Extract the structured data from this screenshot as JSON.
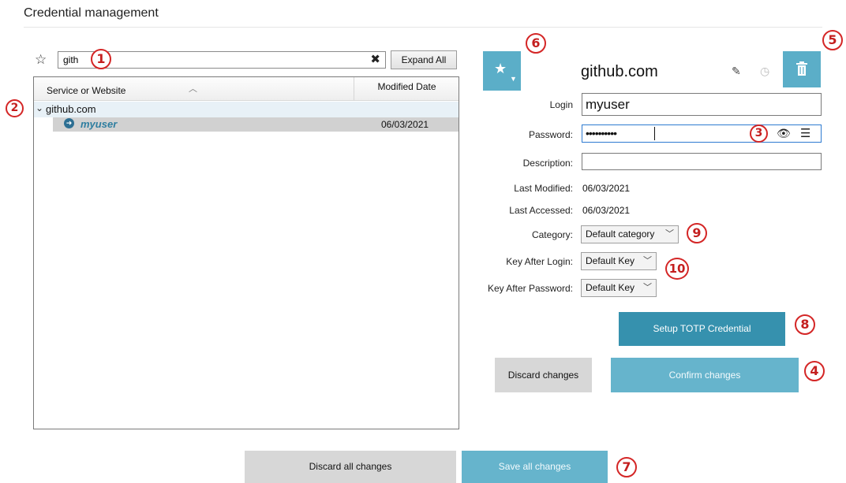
{
  "page": {
    "title": "Credential management"
  },
  "search": {
    "value": "gith",
    "clear_icon": "close-icon",
    "expand_label": "Expand All",
    "favorite_icon": "star-outline-icon"
  },
  "tree": {
    "columns": [
      "Service or Website",
      "Modified Date"
    ],
    "groups": [
      {
        "label": "github.com",
        "expanded": true,
        "items": [
          {
            "user": "myuser",
            "modified": "06/03/2021",
            "selected": true
          }
        ]
      }
    ]
  },
  "detail": {
    "service_name": "github.com",
    "icons": {
      "favorite": "star-icon",
      "edit": "edit-icon",
      "history": "history-icon",
      "delete": "trash-icon"
    },
    "login_label": "Login",
    "login_value": "myuser",
    "password_label": "Password:",
    "password_masked": "••••••••••",
    "description_label": "Description:",
    "description_value": "",
    "last_modified_label": "Last Modified:",
    "last_modified_value": "06/03/2021",
    "last_accessed_label": "Last Accessed:",
    "last_accessed_value": "06/03/2021",
    "category_label": "Category:",
    "category_value": "Default category",
    "key_after_login_label": "Key After Login:",
    "key_after_login_value": "Default Key",
    "key_after_password_label": "Key After Password:",
    "key_after_password_value": "Default Key"
  },
  "actions": {
    "totp": "Setup TOTP Credential",
    "discard": "Discard changes",
    "confirm": "Confirm changes",
    "discard_all": "Discard all changes",
    "save_all": "Save all changes"
  },
  "callouts": [
    "1",
    "2",
    "3",
    "4",
    "5",
    "6",
    "7",
    "8",
    "9",
    "10"
  ],
  "colors": {
    "accent": "#5baec8",
    "accent_dark": "#3691ae",
    "accent_light": "#66b4cc",
    "neutral_button": "#d7d7d7",
    "callout": "#d42626",
    "selected_row": "#d1d1d1",
    "group_row": "#e8f1f7"
  }
}
